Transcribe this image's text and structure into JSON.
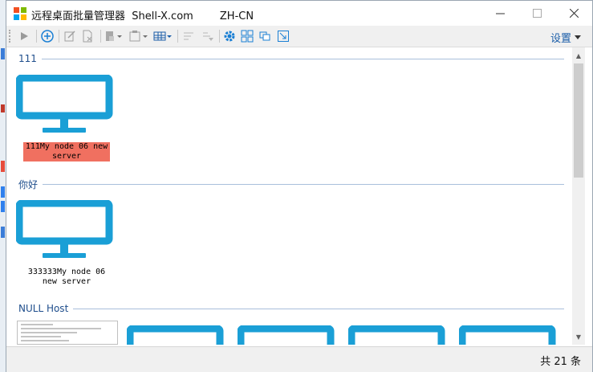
{
  "window": {
    "title": "远程桌面批量管理器  Shell-X.com        ZH-CN",
    "minimize_icon": "minimize-icon",
    "maximize_icon": "maximize-icon",
    "close_icon": "close-icon"
  },
  "toolbar": {
    "settings_label": "设置"
  },
  "groups": [
    {
      "name": "111",
      "nodes": [
        {
          "label": "111My node 06 new server",
          "selected": true
        }
      ]
    },
    {
      "name": "你好",
      "nodes": [
        {
          "label": "333333My node 06 new server",
          "selected": false
        }
      ]
    },
    {
      "name": "NULL Host",
      "nodes": []
    }
  ],
  "status": {
    "count_text": "共 21 条"
  },
  "colors": {
    "accent": "#1a9fd6",
    "selected_label_bg": "#f07060",
    "group_text": "#1f4e8c"
  }
}
